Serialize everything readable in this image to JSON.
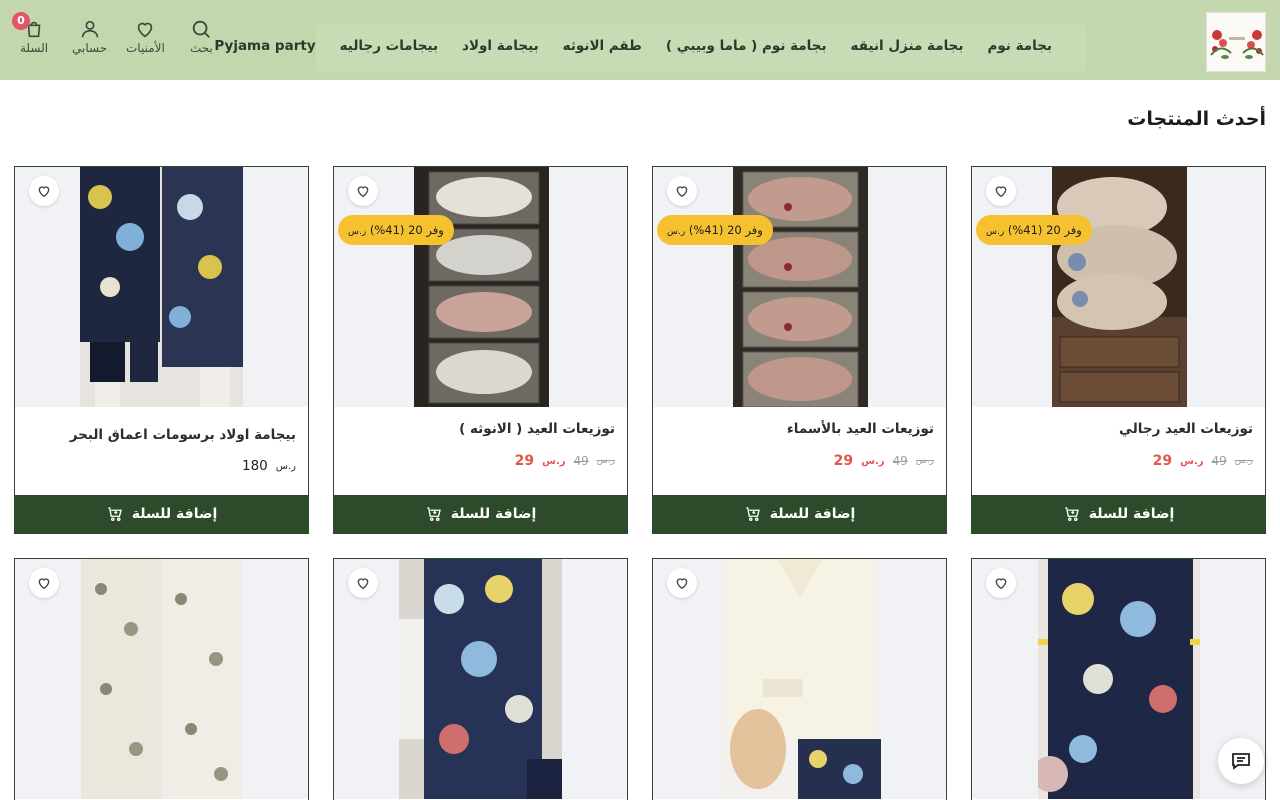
{
  "header": {
    "nav": [
      "بجامة نوم",
      "بجامة منزل انيقه",
      "بجامة نوم ( ماما وبيبي )",
      "طقم الانوثه",
      "بيجامة اولاد",
      "بيجامات رجاليه",
      "Pyjama party"
    ],
    "search_label": "بحث",
    "wishlist_label": "الأمنيات",
    "account_label": "حسابي",
    "cart_label": "السلة",
    "cart_count": "0"
  },
  "section_title": "أحدث المنتجات",
  "currency": "ر.س",
  "products": [
    {
      "name": "توزيعات العيد رجالي",
      "price": "29",
      "old_price": "49",
      "discount": "وفر 20 (41%)",
      "add_label": "إضافة للسلة"
    },
    {
      "name": "توزيعات العيد بالأسماء",
      "price": "29",
      "old_price": "49",
      "discount": "وفر 20 (41%)",
      "add_label": "إضافة للسلة"
    },
    {
      "name": "توزيعات العيد ( الانوثه )",
      "price": "29",
      "old_price": "49",
      "discount": "وفر 20 (41%)",
      "add_label": "إضافة للسلة"
    },
    {
      "name": "بيجامة اولاد برسومات اعماق البحر",
      "price": "180",
      "add_label": "إضافة للسلة"
    }
  ],
  "colors": {
    "header_bg": "#c3d6ad",
    "button_bg": "#2d4a2b",
    "badge_bg": "#f6c12f",
    "sale_price": "#e1574b",
    "cart_badge": "#e0566a"
  }
}
